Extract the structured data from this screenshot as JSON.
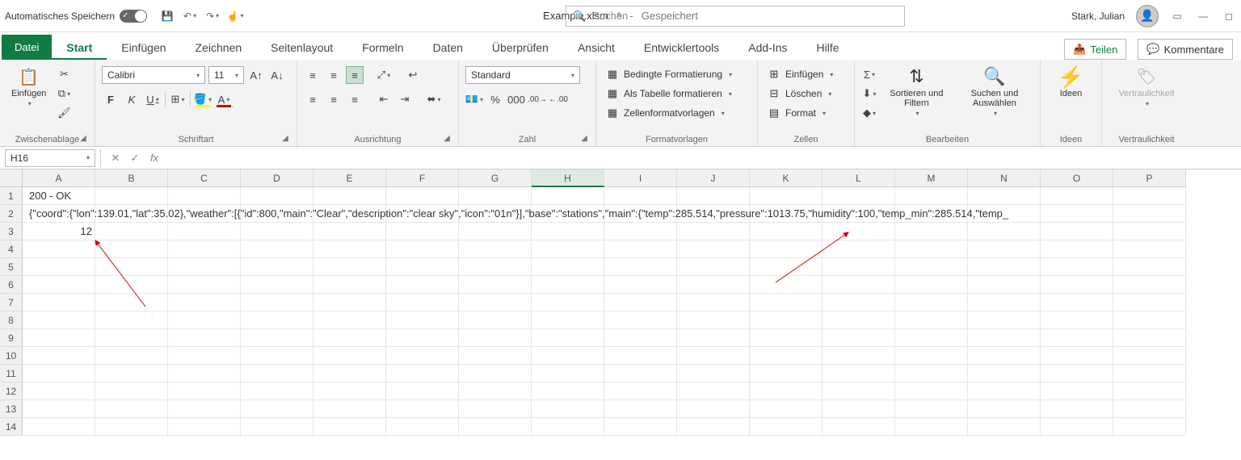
{
  "titlebar": {
    "autosave_label": "Automatisches Speichern",
    "document_name": "Example.xlsm",
    "save_status_sep": "-",
    "save_status": "Gespeichert",
    "search_placeholder": "Suchen",
    "user_name": "Stark, Julian"
  },
  "tabs": {
    "file": "Datei",
    "list": [
      "Start",
      "Einfügen",
      "Zeichnen",
      "Seitenlayout",
      "Formeln",
      "Daten",
      "Überprüfen",
      "Ansicht",
      "Entwicklertools",
      "Add-Ins",
      "Hilfe"
    ],
    "active": "Start",
    "share": "Teilen",
    "comments": "Kommentare"
  },
  "ribbon": {
    "clipboard": {
      "paste": "Einfügen",
      "label": "Zwischenablage"
    },
    "font": {
      "name": "Calibri",
      "size": "11",
      "label": "Schriftart",
      "bold": "F",
      "italic": "K",
      "underline": "U"
    },
    "alignment": {
      "label": "Ausrichtung"
    },
    "number": {
      "format": "Standard",
      "label": "Zahl"
    },
    "styles": {
      "cond": "Bedingte Formatierung",
      "table": "Als Tabelle formatieren",
      "cellstyles": "Zellenformatvorlagen",
      "label": "Formatvorlagen"
    },
    "cells": {
      "insert": "Einfügen",
      "delete": "Löschen",
      "format": "Format",
      "label": "Zellen"
    },
    "editing": {
      "sort": "Sortieren und Filtern",
      "find": "Suchen und Auswählen",
      "label": "Bearbeiten"
    },
    "ideas": {
      "btn": "Ideen",
      "label": "Ideen"
    },
    "sensitivity": {
      "btn": "Vertraulichkeit",
      "label": "Vertraulichkeit"
    }
  },
  "formula_bar": {
    "name_box": "H16",
    "formula": ""
  },
  "grid": {
    "columns": [
      "A",
      "B",
      "C",
      "D",
      "E",
      "F",
      "G",
      "H",
      "I",
      "J",
      "K",
      "L",
      "M",
      "N",
      "O",
      "P"
    ],
    "active_col": "H",
    "rows": 14,
    "overflow": {
      "r1": "200 - OK",
      "r2": "{\"coord\":{\"lon\":139.01,\"lat\":35.02},\"weather\":[{\"id\":800,\"main\":\"Clear\",\"description\":\"clear sky\",\"icon\":\"01n\"}],\"base\":\"stations\",\"main\":{\"temp\":285.514,\"pressure\":1013.75,\"humidity\":100,\"temp_min\":285.514,\"temp_"
    },
    "a3": "12",
    "selected": {
      "col": "H",
      "row": 16
    }
  }
}
